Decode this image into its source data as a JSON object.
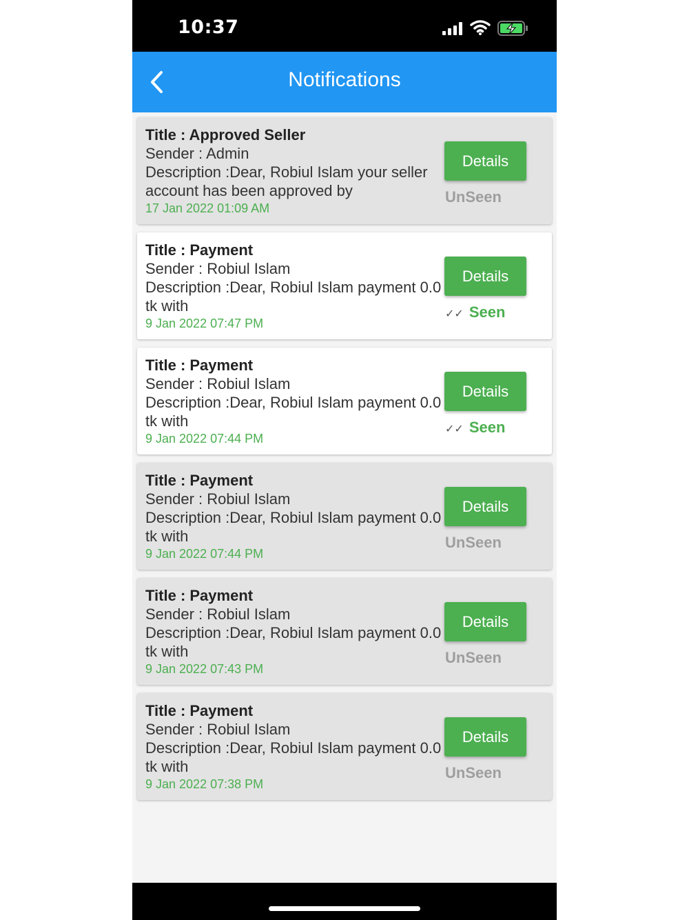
{
  "status_bar": {
    "time": "10:37"
  },
  "app_bar": {
    "title": "Notifications"
  },
  "labels": {
    "details": "Details",
    "unseen": "UnSeen",
    "seen": "Seen",
    "check": "✓✓"
  },
  "notifications": [
    {
      "title_line": "Title  : Approved Seller",
      "sender_line": "Sender  : Admin",
      "desc_line1": "Description :Dear, Robiul Islam your seller",
      "desc_line2": "account has been approved by",
      "date": "17 Jan 2022 01:09 AM",
      "status": "unseen"
    },
    {
      "title_line": "Title  : Payment",
      "sender_line": "Sender  : Robiul Islam",
      "desc_line1": "Description :Dear, Robiul Islam payment 0.0",
      "desc_line2": "tk with",
      "date": "9 Jan 2022 07:47 PM",
      "status": "seen"
    },
    {
      "title_line": "Title  : Payment",
      "sender_line": "Sender  : Robiul Islam",
      "desc_line1": "Description :Dear, Robiul Islam payment 0.0",
      "desc_line2": "tk with",
      "date": "9 Jan 2022 07:44 PM",
      "status": "seen"
    },
    {
      "title_line": "Title  : Payment",
      "sender_line": "Sender  : Robiul Islam",
      "desc_line1": "Description :Dear, Robiul Islam payment 0.0",
      "desc_line2": "tk with",
      "date": "9 Jan 2022 07:44 PM",
      "status": "unseen"
    },
    {
      "title_line": "Title  : Payment",
      "sender_line": "Sender  : Robiul Islam",
      "desc_line1": "Description :Dear, Robiul Islam payment 0.0",
      "desc_line2": "tk with",
      "date": "9 Jan 2022 07:43 PM",
      "status": "unseen"
    },
    {
      "title_line": "Title  : Payment",
      "sender_line": "Sender  : Robiul Islam",
      "desc_line1": "Description :Dear, Robiul Islam payment 0.0",
      "desc_line2": "tk with",
      "date": "9 Jan 2022 07:38 PM",
      "status": "unseen"
    }
  ],
  "colors": {
    "app_bar": "#2196f3",
    "details_button": "#4caf50",
    "date_text": "#4caf50",
    "seen_text": "#4caf50",
    "unseen_text": "#9e9e9e",
    "unseen_card": "#e3e3e3",
    "seen_card": "#ffffff"
  },
  "icons": {
    "back": "chevron-left-icon",
    "signal": "cellular-signal-icon",
    "wifi": "wifi-icon",
    "battery": "battery-charging-icon",
    "seen_check": "double-check-icon"
  }
}
